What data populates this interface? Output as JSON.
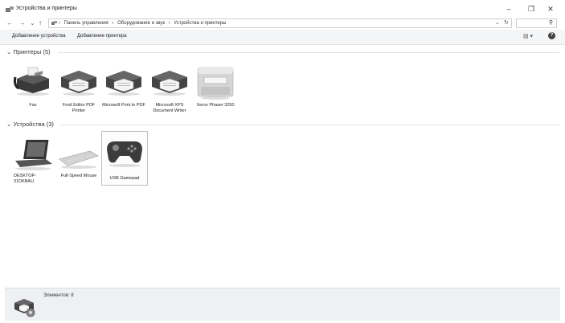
{
  "window": {
    "title": "Устройства и принтеры",
    "minimize": "–",
    "maximize": "❐",
    "close": "✕"
  },
  "nav": {
    "back": "←",
    "forward": "→",
    "dropdown": "⌄",
    "up": "↑"
  },
  "address": {
    "crumbs": [
      "›",
      "Панель управления",
      "›",
      "Оборудование и звук",
      "›",
      "Устройства и принтеры"
    ],
    "dropdown": "⌄",
    "refresh": "↻"
  },
  "search": {
    "icon": "⚲"
  },
  "toolbar": {
    "add_device": "Добавление устройства",
    "add_printer": "Добавление принтера",
    "view_icon": "▤ ▾",
    "help": "?"
  },
  "groups": {
    "printers": {
      "header": "Принтеры (5)",
      "items": [
        {
          "label": "Fax",
          "icon": "fax-icon"
        },
        {
          "label": "Foxit Editor PDF Printer",
          "icon": "printer-icon"
        },
        {
          "label": "Microsoft Print to PDF",
          "icon": "printer-icon"
        },
        {
          "label": "Microsoft XPS Document Writer",
          "icon": "printer-icon"
        },
        {
          "label": "Xerox Phaser 3250",
          "icon": "laser-printer-icon"
        }
      ]
    },
    "devices": {
      "header": "Устройства (3)",
      "items": [
        {
          "label": "DESKTOP-31DKBAU",
          "icon": "laptop-icon"
        },
        {
          "label": "Full-Speed Mouse",
          "icon": "keyboard-icon"
        },
        {
          "label": "USB Gamepad",
          "icon": "gamepad-icon"
        }
      ]
    }
  },
  "status": {
    "text": "Элементов: 8"
  }
}
